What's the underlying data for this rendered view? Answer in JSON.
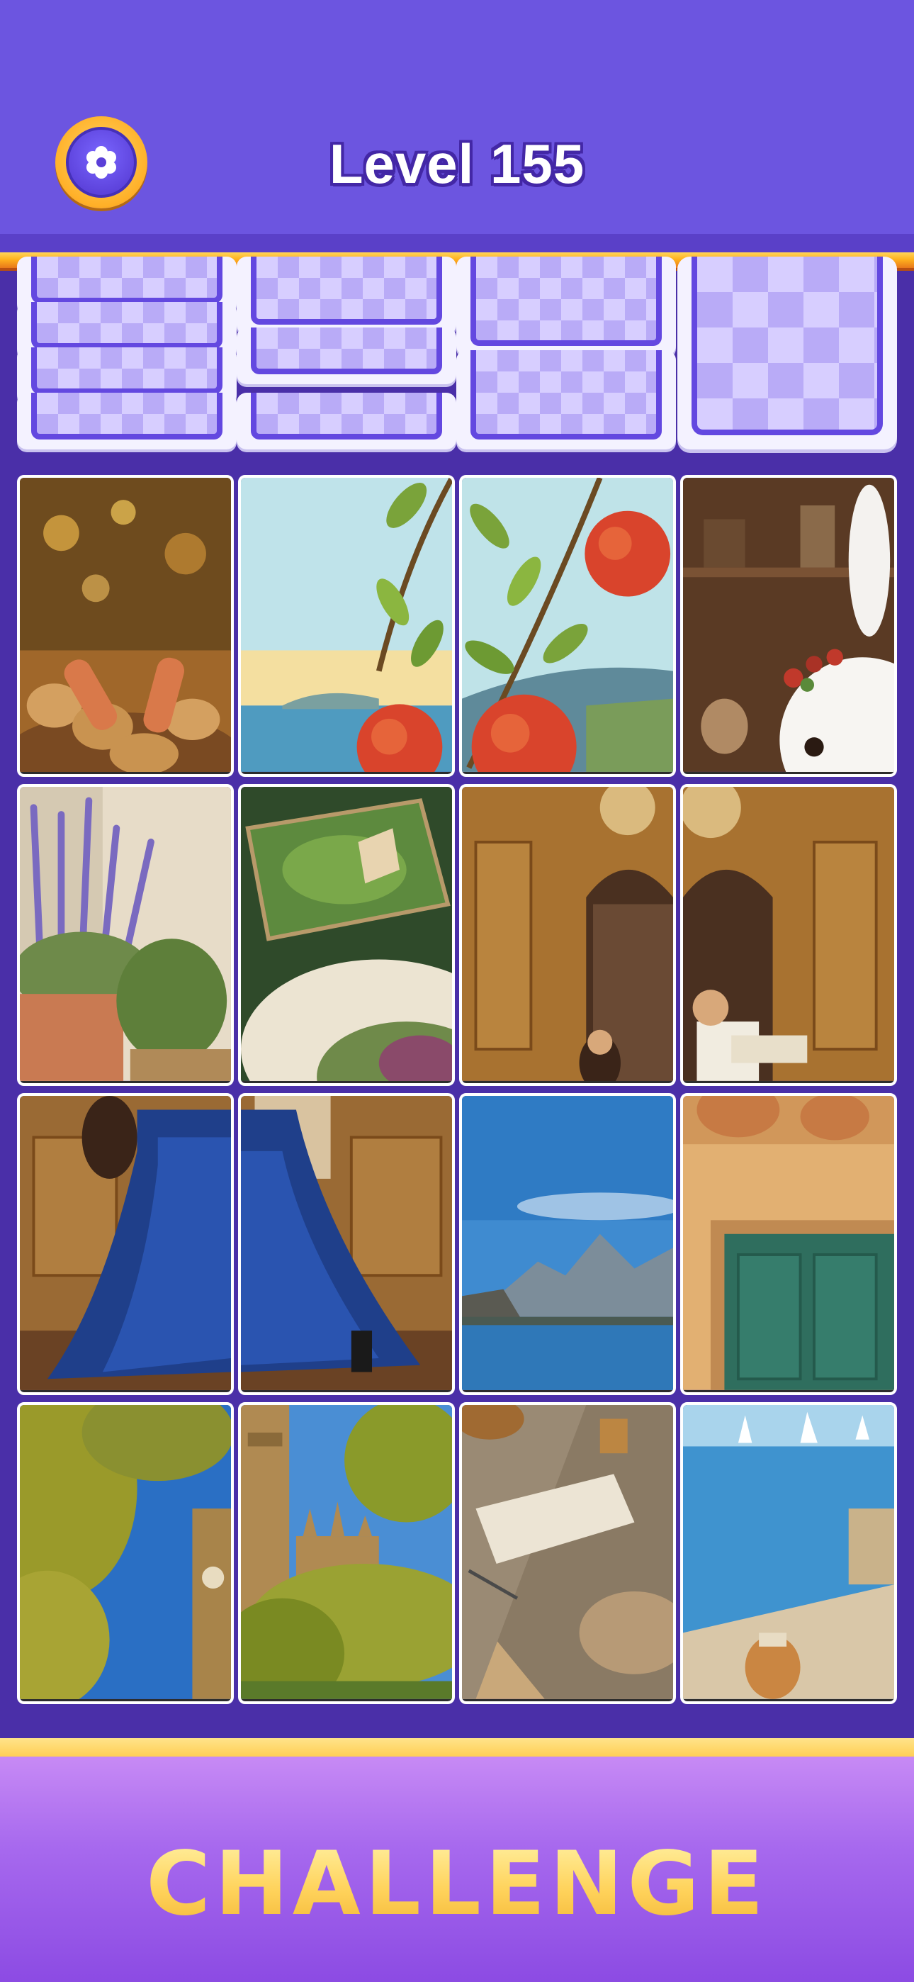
{
  "header": {
    "level_title": "Level 155",
    "settings_icon": "gear-icon"
  },
  "footer": {
    "challenge_label": "CHALLENGE"
  },
  "colors": {
    "header_bg": "#6c55e0",
    "accent_gold": "#ffb21e",
    "board_bg": "#4a2fa8",
    "card_border": "#6348e0"
  },
  "stacks": [
    {
      "name": "stack-1",
      "cards": 4
    },
    {
      "name": "stack-2",
      "cards": 3
    },
    {
      "name": "stack-3",
      "cards": 2
    },
    {
      "name": "stack-4",
      "cards": 1
    }
  ],
  "tiles": [
    "potatoes-basket",
    "sea-pomegranate-left",
    "pomegranate-branch",
    "white-bunny",
    "lavender-herbs",
    "terrarium-plate",
    "ballroom-arch-left",
    "ballroom-couple",
    "blue-dress-left",
    "blue-dress-right",
    "mountain-lake",
    "green-door",
    "trees-clocktower",
    "clocktower-garden",
    "notebook-table",
    "sea-sailboats"
  ]
}
